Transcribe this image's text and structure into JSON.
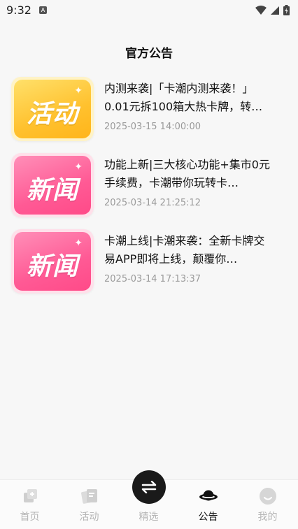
{
  "status": {
    "time": "9:32",
    "a_badge": "A"
  },
  "header": {
    "title": "官方公告"
  },
  "announcements": [
    {
      "badge": "活动",
      "title": "内测来袭|「卡潮内测来袭！」0.01元拆100箱大热卡牌，转…",
      "time": "2025-03-15 14:00:00"
    },
    {
      "badge": "新闻",
      "title": "功能上新|三大核心功能+集市0元手续费，卡潮带你玩转卡…",
      "time": "2025-03-14 21:25:12"
    },
    {
      "badge": "新闻",
      "title": "卡潮上线|卡潮来袭：全新卡牌交易APP即将上线，颠覆你…",
      "time": "2025-03-14 17:13:37"
    }
  ],
  "tabbar": {
    "home": "首页",
    "activity": "活动",
    "featured": "精选",
    "notice": "公告",
    "mine": "我的"
  },
  "colors": {
    "active_tab": "#111111",
    "inactive_tab": "#b5b5b5",
    "activity_badge": "#ffc12e",
    "news_badge": "#ff5a95"
  }
}
